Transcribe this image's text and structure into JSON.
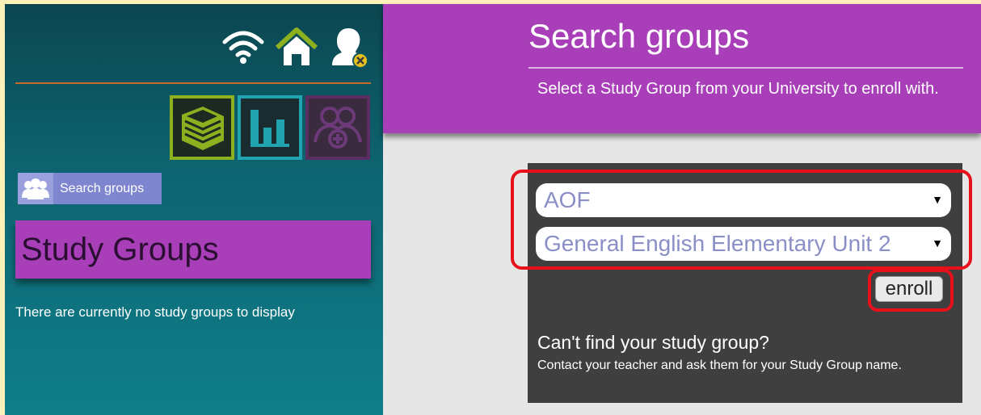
{
  "sidebar": {
    "icons": {
      "wifi": "wifi-icon",
      "home": "home-icon",
      "logout": "user-logout-icon"
    },
    "tiles": [
      {
        "icon": "book-icon",
        "color": "#8cb01e"
      },
      {
        "icon": "chart-icon",
        "color": "#22a3b0"
      },
      {
        "icon": "add-group-icon",
        "color": "#5a2d63"
      }
    ],
    "search_button_label": "Search groups",
    "section_title": "Study Groups",
    "empty_message": "There are currently no study groups to display"
  },
  "main": {
    "title": "Search groups",
    "description": "Select a Study Group from your University to enroll with.",
    "university_select": "AOF",
    "group_select": "General English Elementary Unit 2",
    "enroll_label": "enroll",
    "help_heading": "Can't find your study group?",
    "help_text": "Contact your teacher and ask them for your Study Group name."
  },
  "colors": {
    "accent_purple": "#a83eb8",
    "highlight_red": "#e8101a",
    "teal_panel": "#0d6470"
  }
}
